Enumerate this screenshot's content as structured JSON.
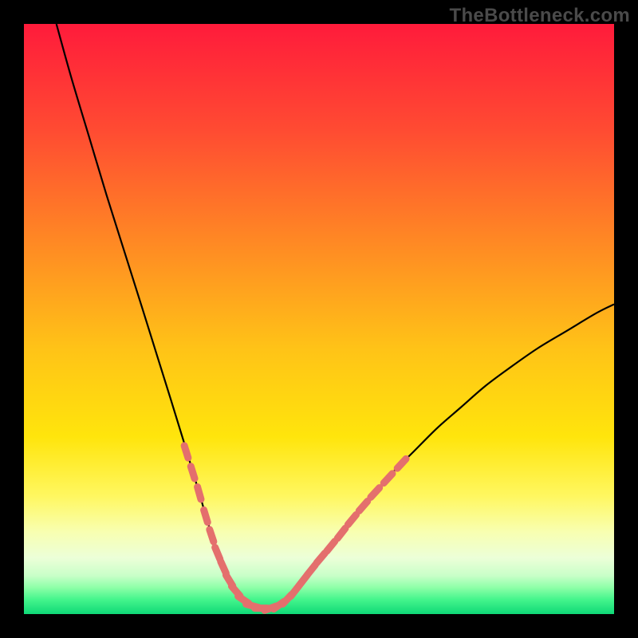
{
  "watermark": "TheBottleneck.com",
  "colors": {
    "frame": "#000000",
    "curve": "#000000",
    "marker": "#e46f6d",
    "gradient_stops": [
      {
        "offset": 0.0,
        "color": "#ff1b3b"
      },
      {
        "offset": 0.18,
        "color": "#ff4b32"
      },
      {
        "offset": 0.38,
        "color": "#ff8c23"
      },
      {
        "offset": 0.55,
        "color": "#ffc317"
      },
      {
        "offset": 0.7,
        "color": "#ffe50c"
      },
      {
        "offset": 0.8,
        "color": "#fff760"
      },
      {
        "offset": 0.86,
        "color": "#f8ffb0"
      },
      {
        "offset": 0.905,
        "color": "#ecffd8"
      },
      {
        "offset": 0.935,
        "color": "#c8ffc8"
      },
      {
        "offset": 0.955,
        "color": "#8effa8"
      },
      {
        "offset": 0.975,
        "color": "#45f58c"
      },
      {
        "offset": 1.0,
        "color": "#0fd977"
      }
    ]
  },
  "chart_data": {
    "type": "line",
    "title": "",
    "xlabel": "",
    "ylabel": "",
    "xlim": [
      0,
      1
    ],
    "ylim": [
      0,
      1
    ],
    "grid": false,
    "legend": false,
    "series": [
      {
        "name": "curve",
        "x": [
          0.055,
          0.08,
          0.11,
          0.14,
          0.17,
          0.2,
          0.225,
          0.25,
          0.27,
          0.285,
          0.3,
          0.31,
          0.32,
          0.33,
          0.34,
          0.35,
          0.36,
          0.38,
          0.4,
          0.42,
          0.44,
          0.46,
          0.48,
          0.51,
          0.54,
          0.58,
          0.62,
          0.66,
          0.7,
          0.74,
          0.78,
          0.82,
          0.87,
          0.92,
          0.97,
          1.0
        ],
        "y": [
          1.0,
          0.91,
          0.81,
          0.71,
          0.615,
          0.52,
          0.44,
          0.36,
          0.295,
          0.245,
          0.195,
          0.16,
          0.13,
          0.1,
          0.075,
          0.055,
          0.04,
          0.02,
          0.01,
          0.01,
          0.02,
          0.04,
          0.065,
          0.1,
          0.14,
          0.19,
          0.235,
          0.275,
          0.315,
          0.35,
          0.385,
          0.415,
          0.45,
          0.48,
          0.51,
          0.525
        ]
      }
    ],
    "markers": {
      "name": "dotted-segments",
      "points": [
        {
          "x": 0.275,
          "y": 0.275
        },
        {
          "x": 0.286,
          "y": 0.24
        },
        {
          "x": 0.297,
          "y": 0.205
        },
        {
          "x": 0.308,
          "y": 0.166
        },
        {
          "x": 0.318,
          "y": 0.133
        },
        {
          "x": 0.328,
          "y": 0.103
        },
        {
          "x": 0.338,
          "y": 0.079
        },
        {
          "x": 0.348,
          "y": 0.057
        },
        {
          "x": 0.359,
          "y": 0.039
        },
        {
          "x": 0.372,
          "y": 0.024
        },
        {
          "x": 0.387,
          "y": 0.014
        },
        {
          "x": 0.402,
          "y": 0.01
        },
        {
          "x": 0.418,
          "y": 0.01
        },
        {
          "x": 0.432,
          "y": 0.015
        },
        {
          "x": 0.446,
          "y": 0.025
        },
        {
          "x": 0.459,
          "y": 0.039
        },
        {
          "x": 0.473,
          "y": 0.057
        },
        {
          "x": 0.487,
          "y": 0.075
        },
        {
          "x": 0.503,
          "y": 0.095
        },
        {
          "x": 0.52,
          "y": 0.115
        },
        {
          "x": 0.538,
          "y": 0.137
        },
        {
          "x": 0.556,
          "y": 0.16
        },
        {
          "x": 0.575,
          "y": 0.183
        },
        {
          "x": 0.595,
          "y": 0.206
        },
        {
          "x": 0.617,
          "y": 0.23
        },
        {
          "x": 0.64,
          "y": 0.255
        }
      ]
    }
  }
}
